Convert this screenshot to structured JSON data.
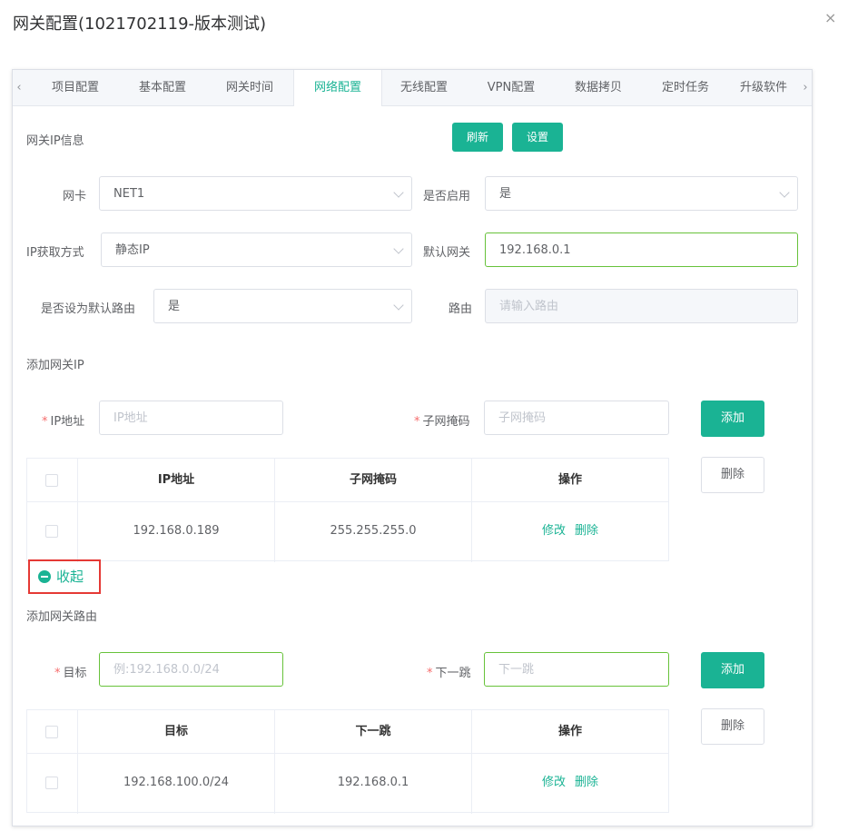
{
  "dialog": {
    "title": "网关配置(1021702119-版本测试)",
    "close_icon": "×"
  },
  "tabs": {
    "prev": "‹",
    "next": "›",
    "items": [
      "项目配置",
      "基本配置",
      "网关时间",
      "网络配置",
      "无线配置",
      "VPN配置",
      "数据拷贝",
      "定时任务",
      "升级软件"
    ],
    "active": "网络配置"
  },
  "ip_info": {
    "section_title": "网关IP信息",
    "refresh_label": "刷新",
    "set_label": "设置",
    "nic_label": "网卡",
    "nic_value": "NET1",
    "enabled_label": "是否启用",
    "enabled_value": "是",
    "ip_mode_label": "IP获取方式",
    "ip_mode_value": "静态IP",
    "gateway_label": "默认网关",
    "gateway_value": "192.168.0.1",
    "default_route_label": "是否设为默认路由",
    "default_route_value": "是",
    "route_label": "路由",
    "route_placeholder": "请输入路由"
  },
  "add_ip": {
    "section_title": "添加网关IP",
    "ip_label": "IP地址",
    "ip_placeholder": "IP地址",
    "mask_label": "子网掩码",
    "mask_placeholder": "子网掩码",
    "add_label": "添加",
    "delete_label": "删除",
    "columns": [
      "IP地址",
      "子网掩码",
      "操作"
    ],
    "rows": [
      {
        "ip": "192.168.0.189",
        "mask": "255.255.255.0"
      }
    ],
    "edit_label": "修改",
    "row_delete_label": "删除",
    "collapse_label": "收起"
  },
  "add_route": {
    "section_title": "添加网关路由",
    "target_label": "目标",
    "target_placeholder": "例:192.168.0.0/24",
    "hop_label": "下一跳",
    "hop_placeholder": "下一跳",
    "add_label": "添加",
    "delete_label": "删除",
    "columns": [
      "目标",
      "下一跳",
      "操作"
    ],
    "rows": [
      {
        "target": "192.168.100.0/24",
        "hop": "192.168.0.1"
      }
    ],
    "edit_label": "修改",
    "row_delete_label": "删除"
  },
  "colors": {
    "accent": "#1ab394",
    "focus_border": "#67c23a",
    "required": "#f56c6c",
    "highlight_box": "#e53935"
  }
}
